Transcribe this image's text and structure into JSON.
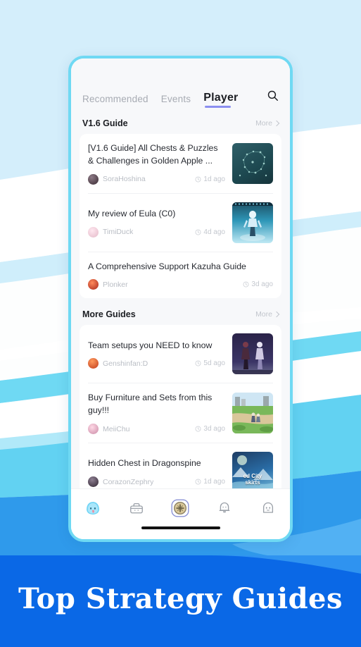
{
  "app": {
    "accent_purple": "#8b8ff0",
    "frame_color": "#6fd9f3",
    "banner_blue": "#0a68e6"
  },
  "tabs": [
    {
      "label": "Recommended",
      "active": false
    },
    {
      "label": "Events",
      "active": false
    },
    {
      "label": "Player",
      "active": true
    }
  ],
  "search": {
    "icon": "search-icon"
  },
  "sections": [
    {
      "title": "V1.6 Guide",
      "more_label": "More",
      "items": [
        {
          "title": "[V1.6 Guide] All Chests & Puzzles & Challenges in Golden Apple ...",
          "author": "SoraHoshina",
          "time": "1d ago",
          "has_thumb": true,
          "thumb_caption": ""
        },
        {
          "title": "My review of Eula (C0)",
          "author": "TimiDuck",
          "time": "4d ago",
          "has_thumb": true,
          "thumb_caption": ""
        },
        {
          "title": "A Comprehensive Support Kazuha Guide",
          "author": "Plonker",
          "time": "3d ago",
          "has_thumb": false,
          "thumb_caption": ""
        }
      ]
    },
    {
      "title": "More Guides",
      "more_label": "More",
      "items": [
        {
          "title": "Team setups you NEED to know",
          "author": "Genshinfan:D",
          "time": "5d ago",
          "has_thumb": true,
          "thumb_caption": ""
        },
        {
          "title": "Buy Furniture and Sets from this guy!!!",
          "author": "MeiiChu",
          "time": "3d ago",
          "has_thumb": true,
          "thumb_caption": ""
        },
        {
          "title": "Hidden Chest in Dragonspine",
          "author": "CorazonZephry",
          "time": "1d ago",
          "has_thumb": true,
          "thumb_caption": "ed City\nskirts"
        }
      ]
    }
  ],
  "nav": [
    {
      "icon": "slime-home-icon",
      "active": true
    },
    {
      "icon": "toolbox-icon",
      "active": false
    },
    {
      "icon": "add-star-button-icon",
      "active": false
    },
    {
      "icon": "bell-icon",
      "active": false
    },
    {
      "icon": "ghost-profile-icon",
      "active": false
    }
  ],
  "banner": {
    "headline": "Top Strategy Guides"
  }
}
